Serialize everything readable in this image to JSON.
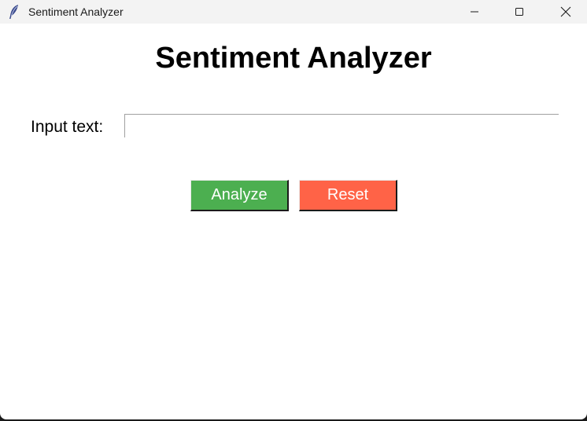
{
  "window": {
    "title": "Sentiment Analyzer",
    "icon": "feather-icon"
  },
  "main": {
    "heading": "Sentiment Analyzer",
    "input_label": "Input text:",
    "input_value": "",
    "analyze_label": "Analyze",
    "reset_label": "Reset"
  },
  "colors": {
    "analyze_button": "#4caf50",
    "reset_button": "#ff6347",
    "titlebar": "#f3f3f3"
  }
}
